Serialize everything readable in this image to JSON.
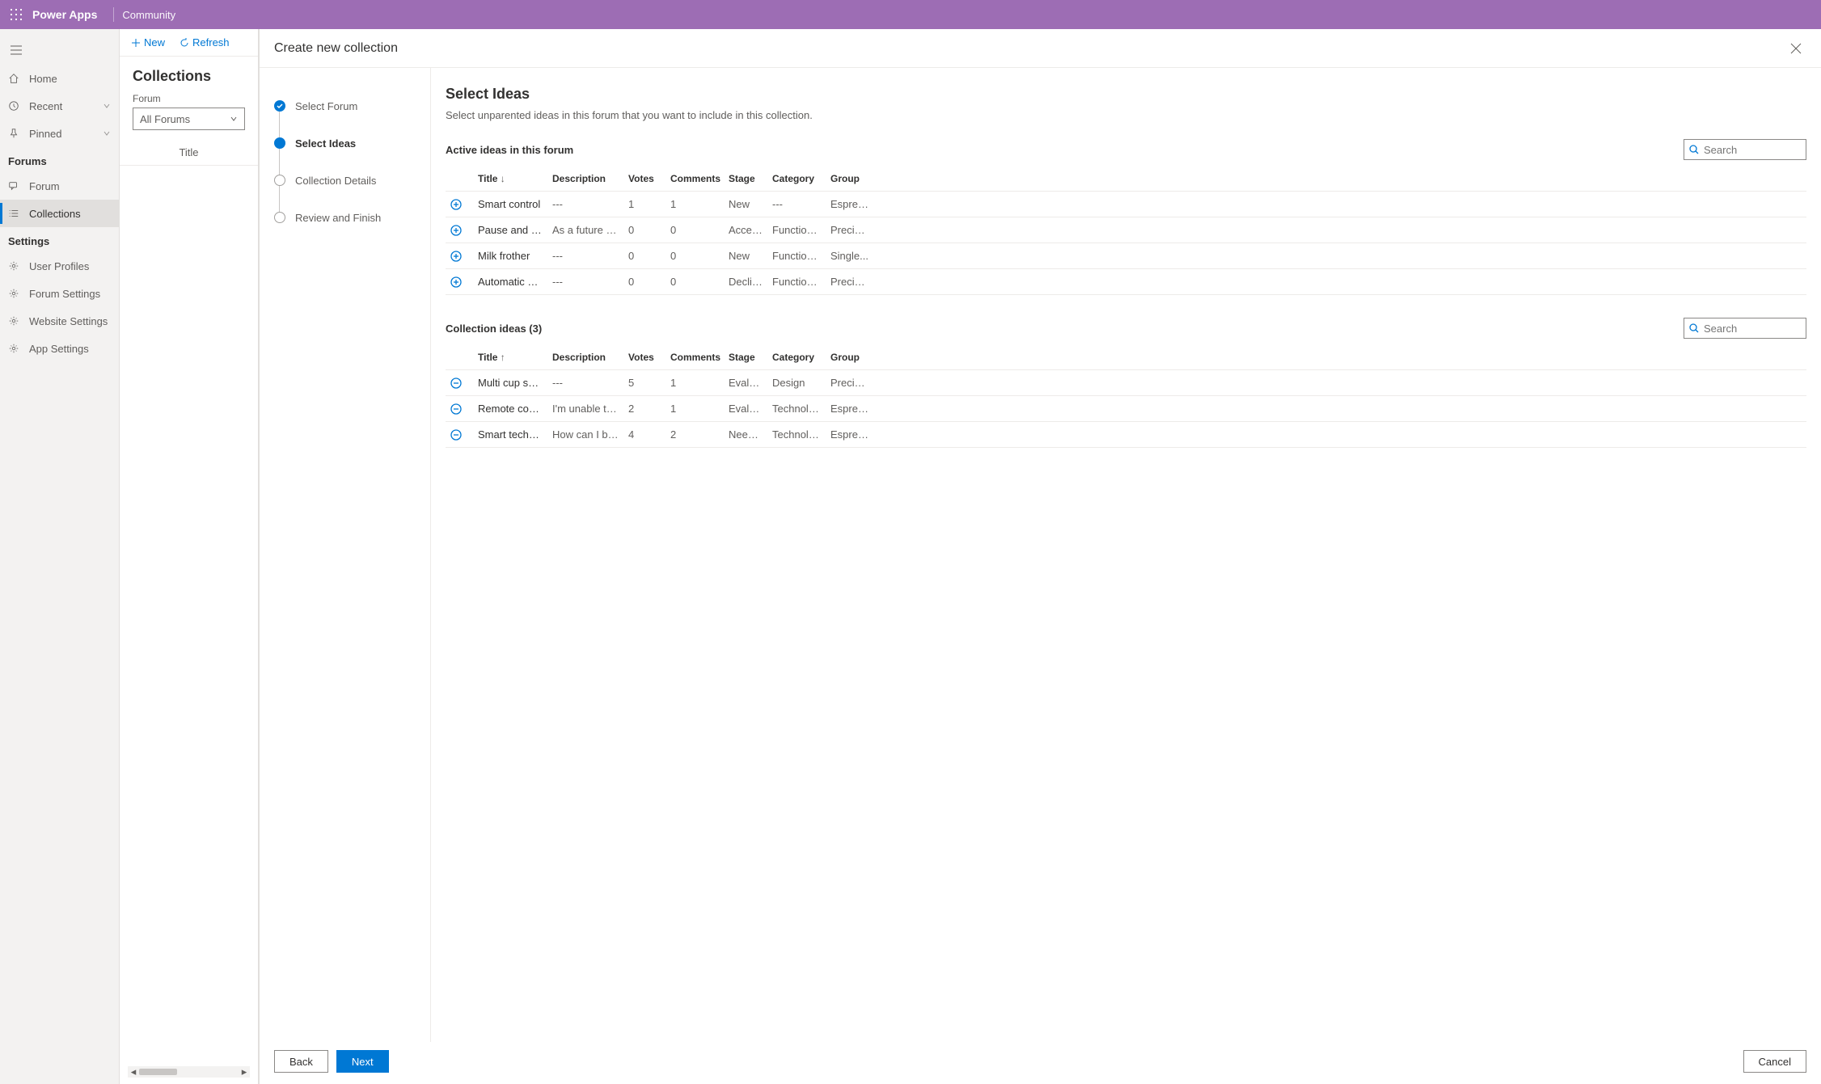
{
  "topbar": {
    "brand": "Power Apps",
    "sub": "Community"
  },
  "nav": {
    "home": "Home",
    "recent": "Recent",
    "pinned": "Pinned",
    "forums_heading": "Forums",
    "forum": "Forum",
    "collections": "Collections",
    "settings_heading": "Settings",
    "user_profiles": "User Profiles",
    "forum_settings": "Forum Settings",
    "website_settings": "Website Settings",
    "app_settings": "App Settings"
  },
  "listpane": {
    "cmd_new": "New",
    "cmd_refresh": "Refresh",
    "heading": "Collections",
    "forum_label": "Forum",
    "forum_value": "All Forums",
    "col_title": "Title"
  },
  "modal": {
    "title": "Create new collection",
    "steps": [
      "Select Forum",
      "Select Ideas",
      "Collection Details",
      "Review and Finish"
    ],
    "content": {
      "heading": "Select Ideas",
      "subtitle": "Select unparented ideas in this forum that you want to include in this collection.",
      "active_section": "Active ideas in this forum",
      "collection_section": "Collection ideas (3)",
      "search_placeholder": "Search"
    },
    "columns": {
      "title": "Title",
      "desc": "Description",
      "votes": "Votes",
      "comments": "Comments",
      "stage": "Stage",
      "category": "Category",
      "group": "Group",
      "sort_down": "↓",
      "sort_up": "↑"
    },
    "active_rows": [
      {
        "title": "Smart control",
        "desc": "---",
        "votes": "1",
        "comments": "1",
        "stage": "New",
        "category": "---",
        "group": "Espres..."
      },
      {
        "title": "Pause and serve",
        "desc": "As a future fea...",
        "votes": "0",
        "comments": "0",
        "stage": "Accep...",
        "category": "Functional...",
        "group": "Precisi..."
      },
      {
        "title": "Milk frother",
        "desc": "---",
        "votes": "0",
        "comments": "0",
        "stage": "New",
        "category": "Functional...",
        "group": "Single..."
      },
      {
        "title": "Automatic shu...",
        "desc": "---",
        "votes": "0",
        "comments": "0",
        "stage": "Declin...",
        "category": "Functional...",
        "group": "Precisi..."
      }
    ],
    "collection_rows": [
      {
        "title": "Multi cup setti...",
        "desc": "---",
        "votes": "5",
        "comments": "1",
        "stage": "Evalua...",
        "category": "Design",
        "group": "Precisi..."
      },
      {
        "title": "Remote control",
        "desc": "I'm unable to ...",
        "votes": "2",
        "comments": "1",
        "stage": "Evalua...",
        "category": "Technology",
        "group": "Espres..."
      },
      {
        "title": "Smart technol...",
        "desc": "How can I bre...",
        "votes": "4",
        "comments": "2",
        "stage": "Needs...",
        "category": "Technology",
        "group": "Espres..."
      }
    ],
    "buttons": {
      "back": "Back",
      "next": "Next",
      "cancel": "Cancel"
    }
  }
}
